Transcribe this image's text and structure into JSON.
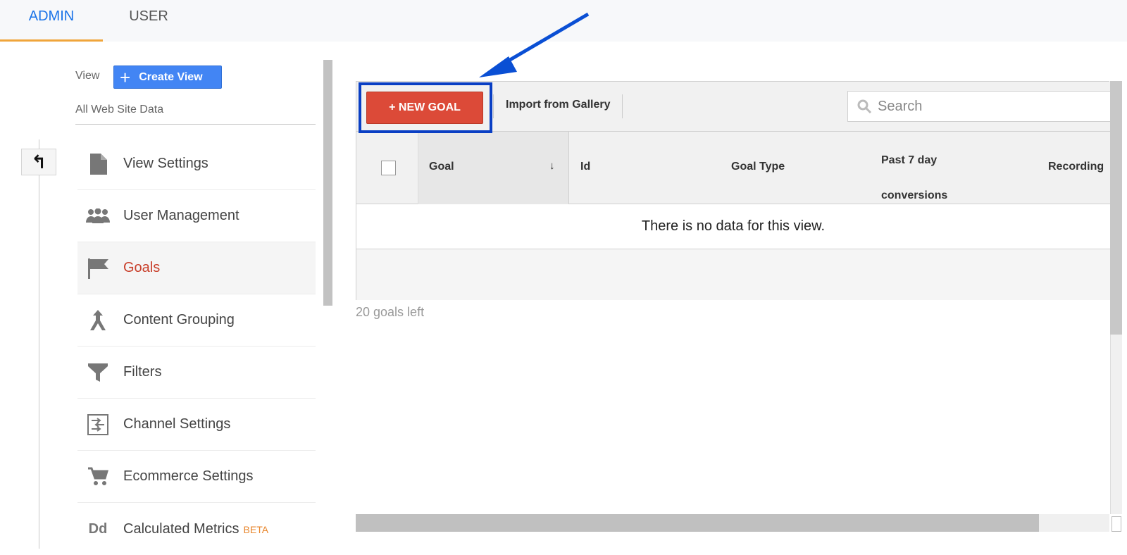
{
  "tabs": {
    "admin": "ADMIN",
    "user": "USER"
  },
  "view_section": {
    "label": "View",
    "create_button": "Create View",
    "current_view": "All Web Site Data"
  },
  "menu": [
    {
      "label": "View Settings",
      "icon": "document-icon"
    },
    {
      "label": "User Management",
      "icon": "users-icon"
    },
    {
      "label": "Goals",
      "icon": "flag-icon",
      "active": true
    },
    {
      "label": "Content Grouping",
      "icon": "content-grouping-icon"
    },
    {
      "label": "Filters",
      "icon": "filter-icon"
    },
    {
      "label": "Channel Settings",
      "icon": "channel-settings-icon"
    },
    {
      "label": "Ecommerce Settings",
      "icon": "cart-icon"
    },
    {
      "label": "Calculated Metrics",
      "icon": "calculated-metrics-icon",
      "badge": "BETA"
    }
  ],
  "toolbar": {
    "new_goal": "+ NEW GOAL",
    "import": "Import from Gallery",
    "search_placeholder": "Search"
  },
  "table": {
    "columns": [
      "Goal",
      "Id",
      "Goal Type",
      "Past 7 day conversions",
      "Recording"
    ],
    "past_line1": "Past 7 day",
    "past_line2": "conversions",
    "empty_message": "There is no data for this view."
  },
  "goals_left": "20 goals left",
  "colors": {
    "accent_blue": "#1a73e8",
    "new_goal_red": "#dc4a38",
    "annotation_blue": "#0a3fc4",
    "active_text": "#c9402c",
    "tab_underline": "#f0a53b"
  },
  "calc_icon_text": "Dd"
}
